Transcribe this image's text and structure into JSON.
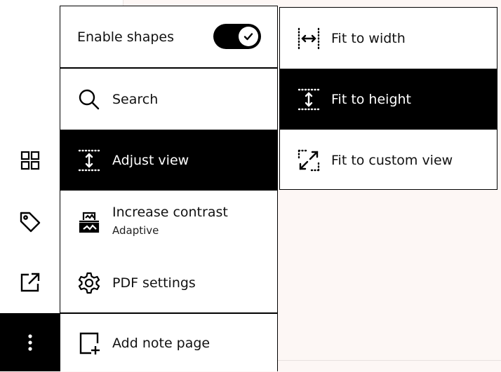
{
  "toolbar": {
    "items": [
      {
        "icon": "grid-icon"
      },
      {
        "icon": "tag-icon"
      },
      {
        "icon": "share-icon"
      },
      {
        "icon": "more-vertical-icon"
      }
    ]
  },
  "menu": {
    "enable_shapes_label": "Enable shapes",
    "enable_shapes_on": true,
    "search_label": "Search",
    "adjust_view_label": "Adjust view",
    "increase_contrast_label": "Increase contrast",
    "increase_contrast_sub": "Adaptive",
    "pdf_settings_label": "PDF settings",
    "add_note_page_label": "Add note page"
  },
  "submenu": {
    "fit_width_label": "Fit to width",
    "fit_height_label": "Fit to height",
    "fit_custom_label": "Fit to custom view",
    "selected": "Fit to height"
  },
  "colors": {
    "accent": "#000000",
    "background": "#fdf7f5",
    "surface": "#ffffff"
  }
}
